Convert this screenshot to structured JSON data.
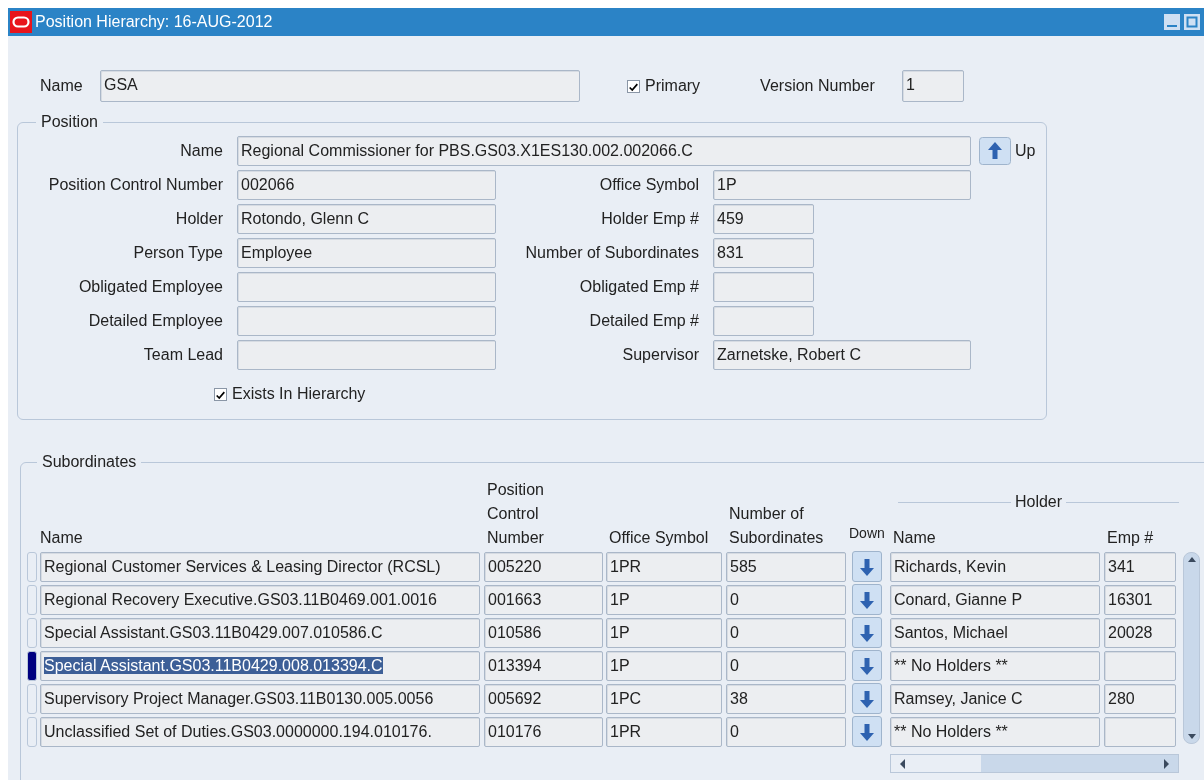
{
  "window": {
    "title": "Position Hierarchy: 16-AUG-2012"
  },
  "header": {
    "name_label": "Name",
    "name_value": "GSA",
    "primary": {
      "label": "Primary",
      "checked": true
    },
    "version_label": "Version Number",
    "version_value": "1"
  },
  "position": {
    "legend": "Position",
    "name": {
      "label": "Name",
      "value": "Regional Commissioner for PBS.GS03.X1ES130.002.002066.C"
    },
    "up_button": "Up",
    "rows": [
      {
        "left": {
          "label": "Position Control Number",
          "value": "002066"
        },
        "right": {
          "label": "Office Symbol",
          "value": "1P",
          "kind": "wide"
        }
      },
      {
        "left": {
          "label": "Holder",
          "value": "Rotondo, Glenn C"
        },
        "right": {
          "label": "Holder Emp #",
          "value": "459",
          "kind": "narrow"
        }
      },
      {
        "left": {
          "label": "Person Type",
          "value": "Employee"
        },
        "right": {
          "label": "Number of Subordinates",
          "value": "831",
          "kind": "narrow"
        }
      },
      {
        "left": {
          "label": "Obligated Employee"
        },
        "right": {
          "label": "Obligated Emp #",
          "kind": "narrow"
        }
      },
      {
        "left": {
          "label": "Detailed Employee"
        },
        "right": {
          "label": "Detailed Emp #",
          "kind": "narrow"
        }
      },
      {
        "left": {
          "label": "Team Lead"
        },
        "right": {
          "label": "Supervisor",
          "value": "Zarnetske, Robert C",
          "kind": "wide"
        }
      }
    ],
    "exists_in_hierarchy": {
      "label": "Exists In Hierarchy",
      "checked": true
    }
  },
  "subordinates": {
    "legend": "Subordinates",
    "columns": [
      "Name",
      "Position Control Number",
      "Office Symbol",
      "Number of Subordinates",
      "Down"
    ],
    "holder_group": "Holder",
    "holder_columns": [
      "Name",
      "Emp #"
    ],
    "rows": [
      {
        "name": "Regional Customer Services & Leasing Director (RCSL)",
        "pcn": "005220",
        "office": "1PR",
        "count": "585",
        "holder": "Richards, Kevin",
        "emp": "341",
        "selected": false
      },
      {
        "name": "Regional Recovery Executive.GS03.11B0469.001.0016",
        "pcn": "001663",
        "office": "1P",
        "count": "0",
        "holder": "Conard, Gianne P",
        "emp": "16301",
        "selected": false
      },
      {
        "name": "Special Assistant.GS03.11B0429.007.010586.C",
        "pcn": "010586",
        "office": "1P",
        "count": "0",
        "holder": "Santos, Michael",
        "emp": "20028",
        "selected": false
      },
      {
        "name": "Special Assistant.GS03.11B0429.008.013394.C",
        "pcn": "013394",
        "office": "1P",
        "count": "0",
        "holder": "** No Holders **",
        "selected": true
      },
      {
        "name": "Supervisory Project Manager.GS03.11B0130.005.0056",
        "pcn": "005692",
        "office": "1PC",
        "count": "38",
        "holder": "Ramsey, Janice C",
        "emp": "280",
        "selected": false
      },
      {
        "name": "Unclassified Set of Duties.GS03.0000000.194.010176.",
        "pcn": "010176",
        "office": "1PR",
        "count": "0",
        "holder": "** No Holders **",
        "selected": false
      }
    ]
  }
}
